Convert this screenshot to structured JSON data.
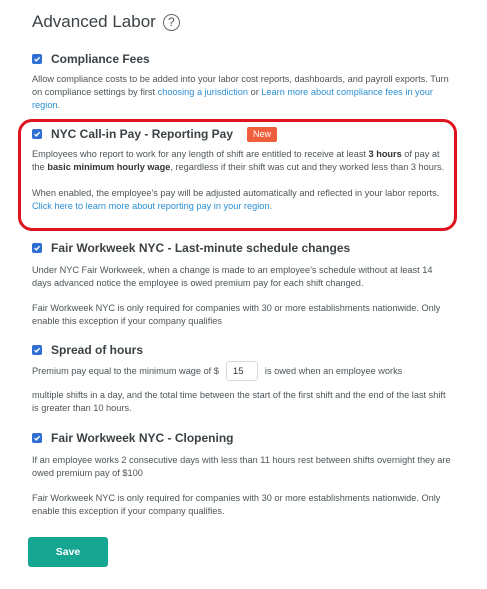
{
  "page": {
    "title": "Advanced Labor",
    "help_icon": "?"
  },
  "compliance": {
    "title": "Compliance Fees",
    "desc_1": "Allow compliance costs to be added into your labor cost reports, dashboards, and payroll exports.",
    "desc_2a": "Turn on compliance settings by first ",
    "link_jurisdiction": "choosing a jurisdiction",
    "desc_2b": " or ",
    "link_learn_fees": "Learn more about compliance fees in your region",
    "desc_2c": "."
  },
  "reporting_pay": {
    "title": "NYC Call-in Pay - Reporting Pay",
    "badge": "New",
    "p1_a": "Employees who report to work for any length of shift are entitled to receive at least ",
    "p1_b": "3 hours",
    "p1_c": " of pay at the ",
    "p1_d": "basic minimum hourly wage",
    "p1_e": ", regardless if their shift was cut and they worked less than 3 hours.",
    "p2_a": "When enabled, the employee's pay will be adjusted automatically and reflected in your labor reports. ",
    "p2_link": "Click here to learn more about reporting pay in your region."
  },
  "last_minute": {
    "title": "Fair Workweek NYC - Last-minute schedule changes",
    "p1": "Under NYC Fair Workweek, when a change is made to an employee's schedule without at least 14 days advanced notice the employee is owed premium pay for each shift changed.",
    "p2": "Fair Workweek NYC is only required for companies with 30 or more establishments nationwide. Only enable this exception if your company qualifies"
  },
  "spread": {
    "title": "Spread of hours",
    "before_input": "Premium pay equal to the minimum wage of $",
    "wage_value": "15",
    "after_input": "is owed when an employee works",
    "p2": "multiple shifts in a day, and the total time between the start of the first shift and the end of the last shift is greater than 10 hours."
  },
  "clopening": {
    "title": "Fair Workweek NYC - Clopening",
    "p1": "If an employee works 2 consecutive days with less than 11 hours rest between shifts overnight they are owed premium pay of $100",
    "p2": "Fair Workweek NYC is only required for companies with 30 or more establishments nationwide. Only enable this exception if your company qualifies."
  },
  "save_label": "Save",
  "colors": {
    "checkbox": "#2e6fd1",
    "badge": "#f05f3c",
    "link": "#2b8fd3",
    "save": "#15a591",
    "highlight": "#e01320"
  }
}
